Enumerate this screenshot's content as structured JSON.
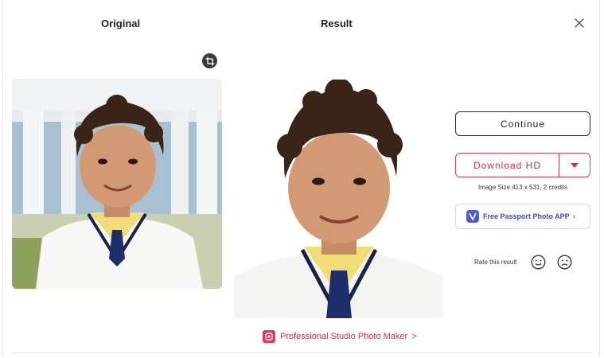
{
  "header": {
    "original_title": "Original",
    "result_title": "Result"
  },
  "actions": {
    "continue_label": "Continue",
    "download_label": "Download HD",
    "image_size_text": "Image Size 413 x 531, 2 credits",
    "passport_label": "Free Passport Photo APP",
    "passport_chevron": "›"
  },
  "rating": {
    "label": "Rate this result"
  },
  "promo": {
    "label": "Professional Studio Photo Maker",
    "chevron": ">"
  },
  "icons": {
    "close": "close-icon",
    "crop": "crop-icon",
    "dropdown": "caret-down-icon",
    "happy": "smile-face-icon",
    "sad": "sad-face-icon",
    "app": "passport-app-icon",
    "promo": "studio-app-icon"
  },
  "colors": {
    "accent_red": "#e0284a",
    "accent_blue": "#3b47c4",
    "border_dark": "#2a2a2a"
  }
}
